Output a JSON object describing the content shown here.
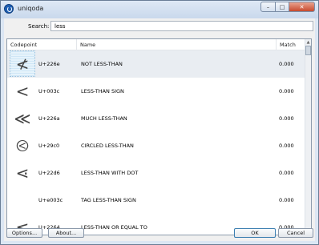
{
  "window": {
    "title": "uniqoda"
  },
  "search": {
    "label": "Search:",
    "value": "less"
  },
  "table": {
    "columns": {
      "codepoint": "Codepoint",
      "name": "Name",
      "match": "Match"
    },
    "rows": [
      {
        "glyph": "≮",
        "glyph_icon": "not-less-than-glyph",
        "codepoint": "U+226e",
        "name": "NOT LESS-THAN",
        "match": "0.000",
        "selected": true
      },
      {
        "glyph": "<",
        "glyph_icon": "less-than-glyph",
        "codepoint": "U+003c",
        "name": "LESS-THAN SIGN",
        "match": "0.000",
        "selected": false
      },
      {
        "glyph": "≪",
        "glyph_icon": "much-less-than-glyph",
        "codepoint": "U+226a",
        "name": "MUCH LESS-THAN",
        "match": "0.000",
        "selected": false
      },
      {
        "glyph": "⧀",
        "glyph_icon": "circled-less-than-glyph",
        "codepoint": "U+29c0",
        "name": "CIRCLED LESS-THAN",
        "match": "0.000",
        "selected": false
      },
      {
        "glyph": "⋖",
        "glyph_icon": "less-than-with-dot-glyph",
        "codepoint": "U+22d6",
        "name": "LESS-THAN WITH DOT",
        "match": "0.000",
        "selected": false
      },
      {
        "glyph": "",
        "glyph_icon": "tag-less-than-glyph",
        "codepoint": "U+e003c",
        "name": "TAG LESS-THAN SIGN",
        "match": "0.000",
        "selected": false
      },
      {
        "glyph": "≤",
        "glyph_icon": "less-than-or-equal-glyph",
        "codepoint": "U+2264",
        "name": "LESS-THAN OR EQUAL TO",
        "match": "0.000",
        "selected": false
      }
    ]
  },
  "buttons": {
    "options": "Options...",
    "about": "About...",
    "ok": "OK",
    "cancel": "Cancel"
  }
}
